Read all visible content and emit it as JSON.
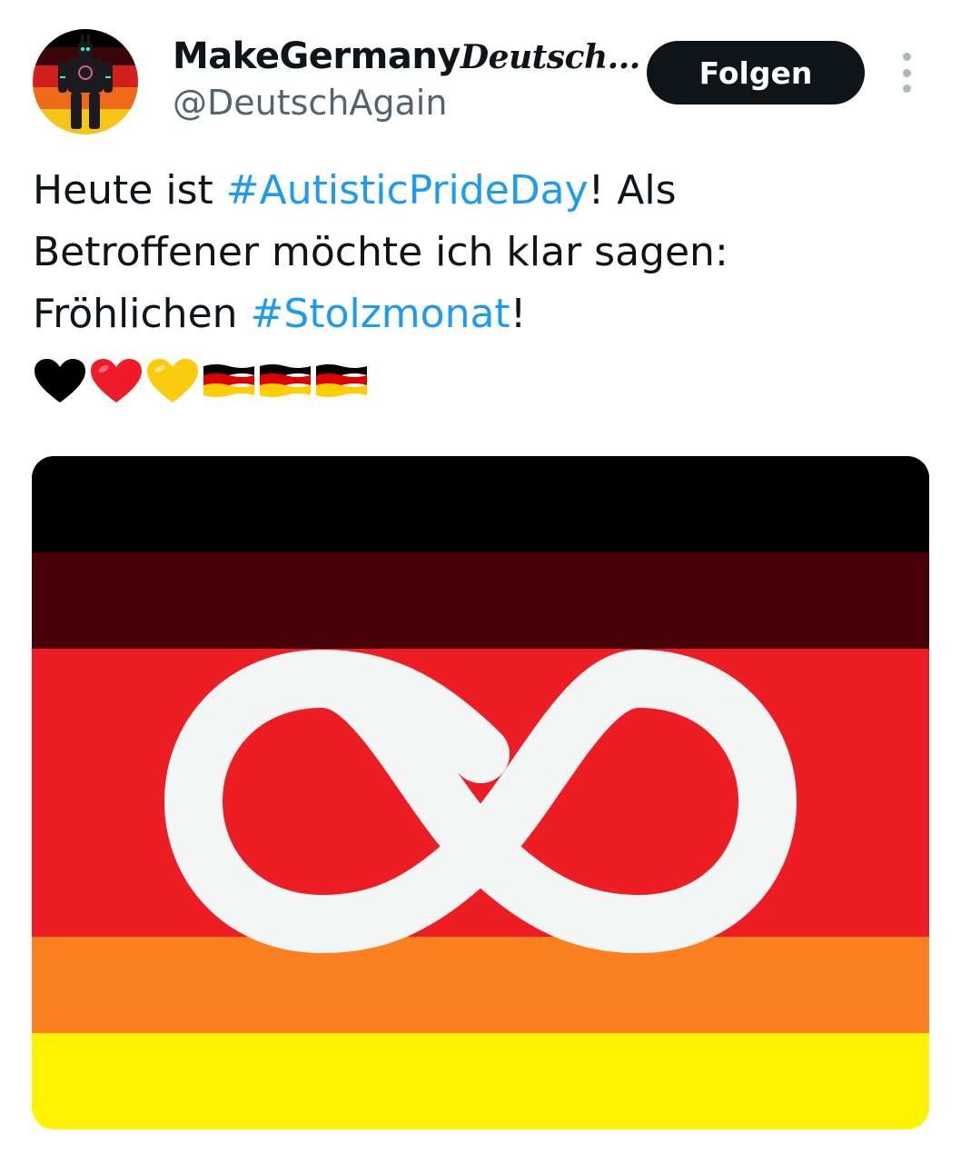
{
  "tweet": {
    "author": {
      "display_name_main": "MakeGermany",
      "display_name_tail": "Deutsch...",
      "handle": "@DeutschAgain"
    },
    "follow_label": "Folgen",
    "text": {
      "l1_a": "Heute ist ",
      "hashtag1": "#AutisticPrideDay",
      "l1_b": "! Als",
      "l2": "Betroffener möchte ich klar sagen:",
      "l3_a": "Fröhlichen ",
      "hashtag2": "#Stolzmonat",
      "l3_b": "!"
    },
    "emojis": [
      "black-heart",
      "red-heart",
      "yellow-heart",
      "germany-flag",
      "germany-flag",
      "germany-flag"
    ],
    "media": {
      "stripe_colors": [
        "#000000",
        "#4a0209",
        "#ee1c23",
        "#ee1c23",
        "#ee1c23",
        "#fd8020",
        "#fef200"
      ],
      "symbol": "infinity",
      "symbol_color": "#f4f6f6"
    },
    "colors": {
      "text": "#0f1419",
      "secondary": "#536471",
      "link": "#1d9bf0",
      "button_bg": "#0f1419"
    }
  }
}
